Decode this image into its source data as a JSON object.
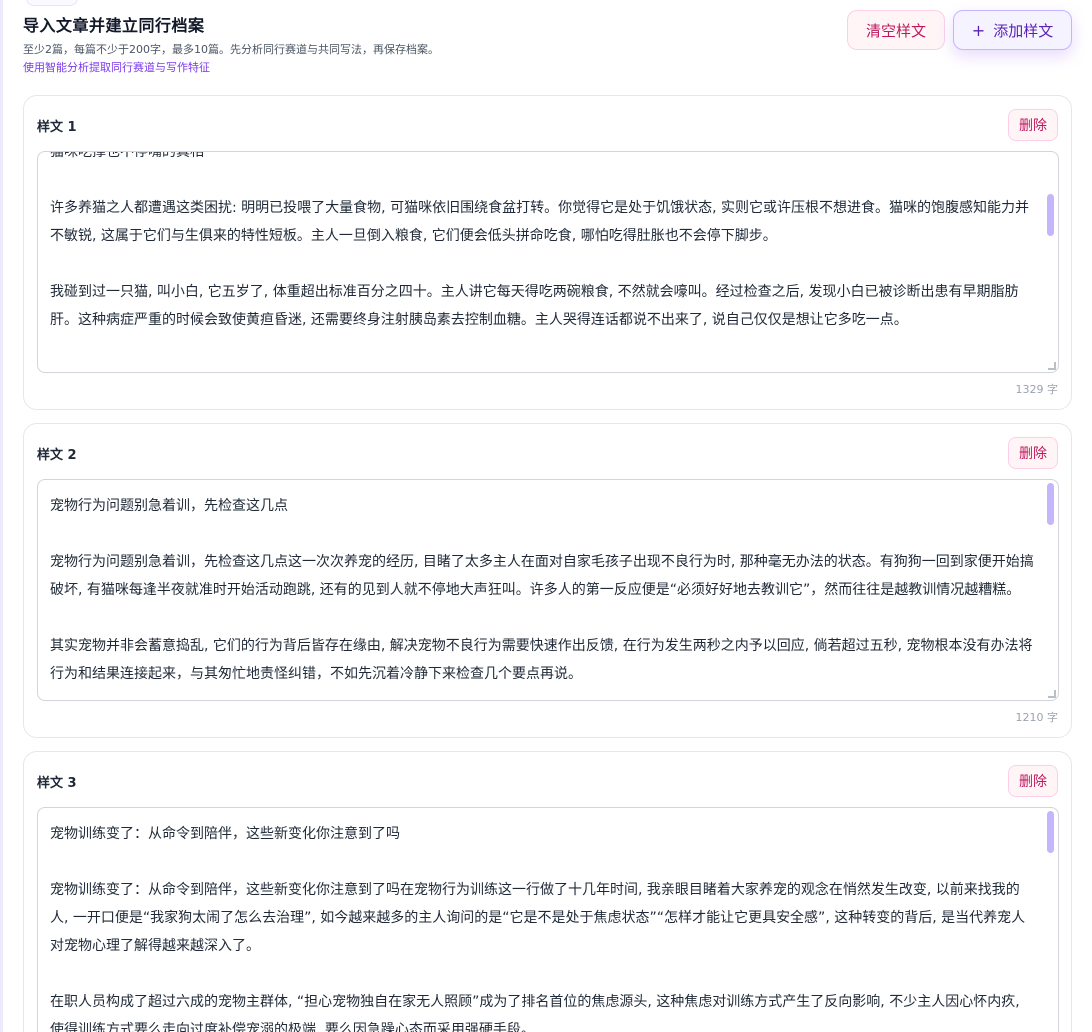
{
  "header": {
    "title": "导入文章并建立同行档案",
    "subtitle": "至少2篇，每篇不少于200字，最多10篇。先分析同行赛道与共同写法，再保存档案。",
    "hint_link": "使用智能分析提取同行赛道与写作特征"
  },
  "actions": {
    "clear_label": "清空样文",
    "add_plus": "+",
    "add_label": "添加样文"
  },
  "samples": [
    {
      "label": "样文 1",
      "delete_label": "删除",
      "partial_line": "猫咪吃撑也不停嘴的真相",
      "paragraphs": [
        "许多养猫之人都遭遇这类困扰: 明明已投喂了大量食物, 可猫咪依旧围绕食盆打转。你觉得它是处于饥饿状态, 实则它或许压根不想进食。猫咪的饱腹感知能力并不敏锐, 这属于它们与生俱来的特性短板。主人一旦倒入粮食, 它们便会低头拼命吃食, 哪怕吃得肚胀也不会停下脚步。",
        "我碰到过一只猫, 叫小白, 它五岁了, 体重超出标准百分之四十。主人讲它每天得吃两碗粮食, 不然就会嚎叫。经过检查之后, 发现小白已被诊断出患有早期脂肪肝。这种病症严重的时候会致使黄疸昏迷, 还需要终身注射胰岛素去控制血糖。主人哭得连话都说不出来了, 说自己仅仅是想让它多吃一点。"
      ],
      "count": "1329 字"
    },
    {
      "label": "样文 2",
      "delete_label": "删除",
      "partial_line": "",
      "paragraphs": [
        "宠物行为问题别急着训，先检查这几点",
        "宠物行为问题别急着训，先检查这几点这一次次养宠的经历, 目睹了太多主人在面对自家毛孩子出现不良行为时, 那种毫无办法的状态。有狗狗一回到家便开始搞破坏, 有猫咪每逢半夜就准时开始活动跑跳, 还有的见到人就不停地大声狂叫。许多人的第一反应便是“必须好好地去教训它”，然而往往是越教训情况越糟糕。",
        "其实宠物并非会蓄意捣乱, 它们的行为背后皆存在缘由, 解决宠物不良行为需要快速作出反馈, 在行为发生两秒之内予以回应, 倘若超过五秒, 宠物根本没有办法将行为和结果连接起来，与其匆忙地责怪纠错，不如先沉着冷静下来检查几个要点再说。"
      ],
      "count": "1210 字"
    },
    {
      "label": "样文 3",
      "delete_label": "删除",
      "partial_line": "",
      "paragraphs": [
        "宠物训练变了：从命令到陪伴，这些新变化你注意到了吗",
        "宠物训练变了：从命令到陪伴，这些新变化你注意到了吗在宠物行为训练这一行做了十几年时间, 我亲眼目睹着大家养宠的观念在悄然发生改变, 以前来找我的人, 一开口便是“我家狗太闹了怎么去治理”, 如今越来越多的主人询问的是“它是不是处于焦虑状态”“怎样才能让它更具安全感”, 这种转变的背后, 是当代养宠人对宠物心理了解得越来越深入了。",
        "在职人员构成了超过六成的宠物主群体, “担心宠物独自在家无人照顾”成为了排名首位的焦虑源头, 这种焦虑对训练方式产生了反向影响, 不少主人因心怀内疚, 使得训练方式要么走向过度补偿宠溺的极端, 要么因急躁心态而采用强硬手段。"
      ],
      "count": ""
    }
  ]
}
